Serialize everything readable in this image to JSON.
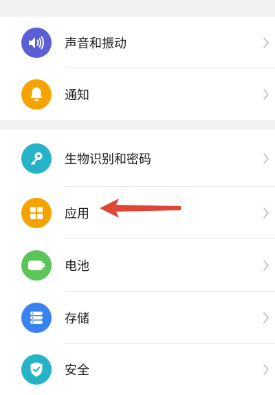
{
  "colors": {
    "sound": "#5b5fd6",
    "notify": "#f5a300",
    "biometric": "#26b3c8",
    "apps": "#f5a300",
    "battery": "#5cc55a",
    "storage": "#3a82f0",
    "security": "#26b3c8",
    "annotation_arrow": "#e14535"
  },
  "groups": [
    {
      "items": [
        {
          "label": "声音和振动",
          "icon": "speaker-icon"
        },
        {
          "label": "通知",
          "icon": "bell-icon"
        }
      ]
    },
    {
      "items": [
        {
          "label": "生物识别和密码",
          "icon": "key-icon"
        },
        {
          "label": "应用",
          "icon": "apps-grid-icon"
        },
        {
          "label": "电池",
          "icon": "battery-icon"
        },
        {
          "label": "存储",
          "icon": "storage-icon"
        },
        {
          "label": "安全",
          "icon": "shield-check-icon"
        }
      ]
    }
  ]
}
